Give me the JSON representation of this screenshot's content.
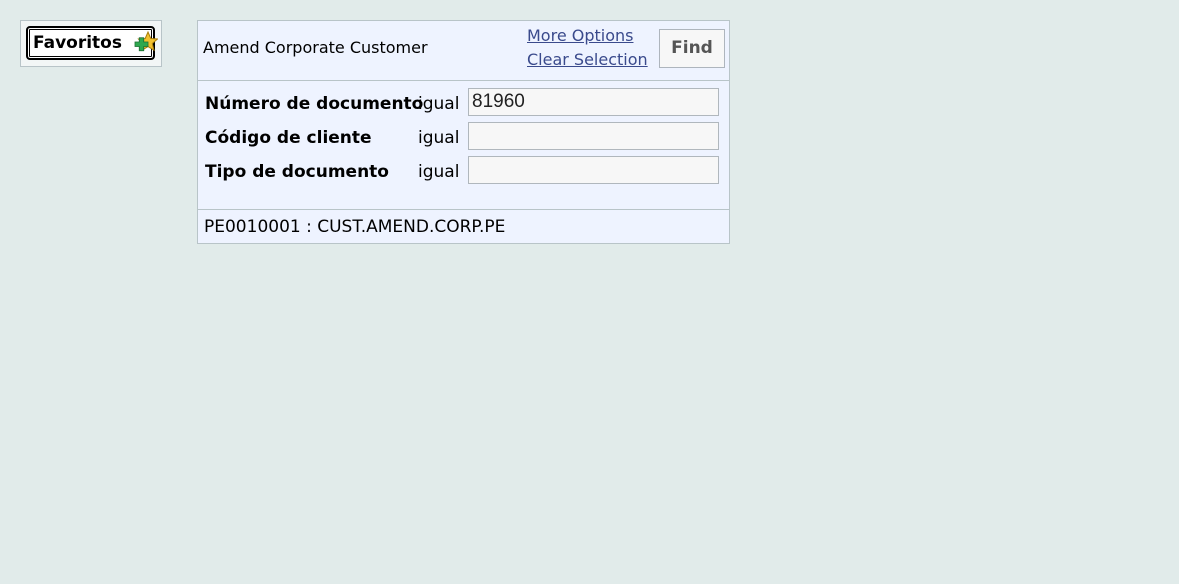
{
  "favorites": {
    "label": "Favoritos",
    "icon": "star-plus-icon"
  },
  "panel": {
    "title": "Amend Corporate Customer",
    "more_options": "More Options",
    "clear_selection": "Clear Selection",
    "find_label": "Find",
    "fields": [
      {
        "label": "Número de documento",
        "operator": "igual",
        "value": "81960"
      },
      {
        "label": "Código de cliente",
        "operator": "igual",
        "value": ""
      },
      {
        "label": "Tipo de documento",
        "operator": "igual",
        "value": ""
      }
    ],
    "footer": "PE0010001 : CUST.AMEND.CORP.PE"
  },
  "colors": {
    "background": "#e1ebea",
    "panel": "#eef3ff",
    "link": "#3a4a8c",
    "star": "#f2c12e",
    "plus": "#2fa84f"
  }
}
